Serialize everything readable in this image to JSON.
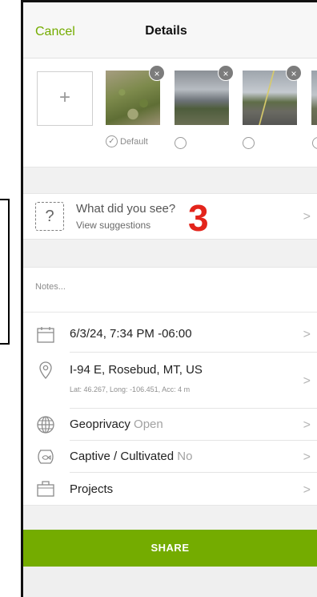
{
  "header": {
    "cancel_label": "Cancel",
    "title": "Details"
  },
  "photos": {
    "add_label": "+",
    "remove_glyph": "×",
    "default_label": "Default",
    "check_glyph": "✓"
  },
  "species": {
    "prompt": "What did you see?",
    "suggestions_label": "View suggestions",
    "question_glyph": "?",
    "annotation_number": "3"
  },
  "notes": {
    "placeholder": "Notes..."
  },
  "details": {
    "datetime": "6/3/24, 7:34 PM -06:00",
    "location": "I-94 E, Rosebud, MT, US",
    "coords": "Lat: 46.267, Long: -106.451, Acc: 4 m",
    "geoprivacy_label": "Geoprivacy",
    "geoprivacy_value": "Open",
    "captive_label": "Captive / Cultivated",
    "captive_value": "No",
    "projects_label": "Projects"
  },
  "chevron": ">",
  "share_label": "SHARE",
  "colors": {
    "accent": "#74ac00",
    "annotation": "#e3241b"
  }
}
